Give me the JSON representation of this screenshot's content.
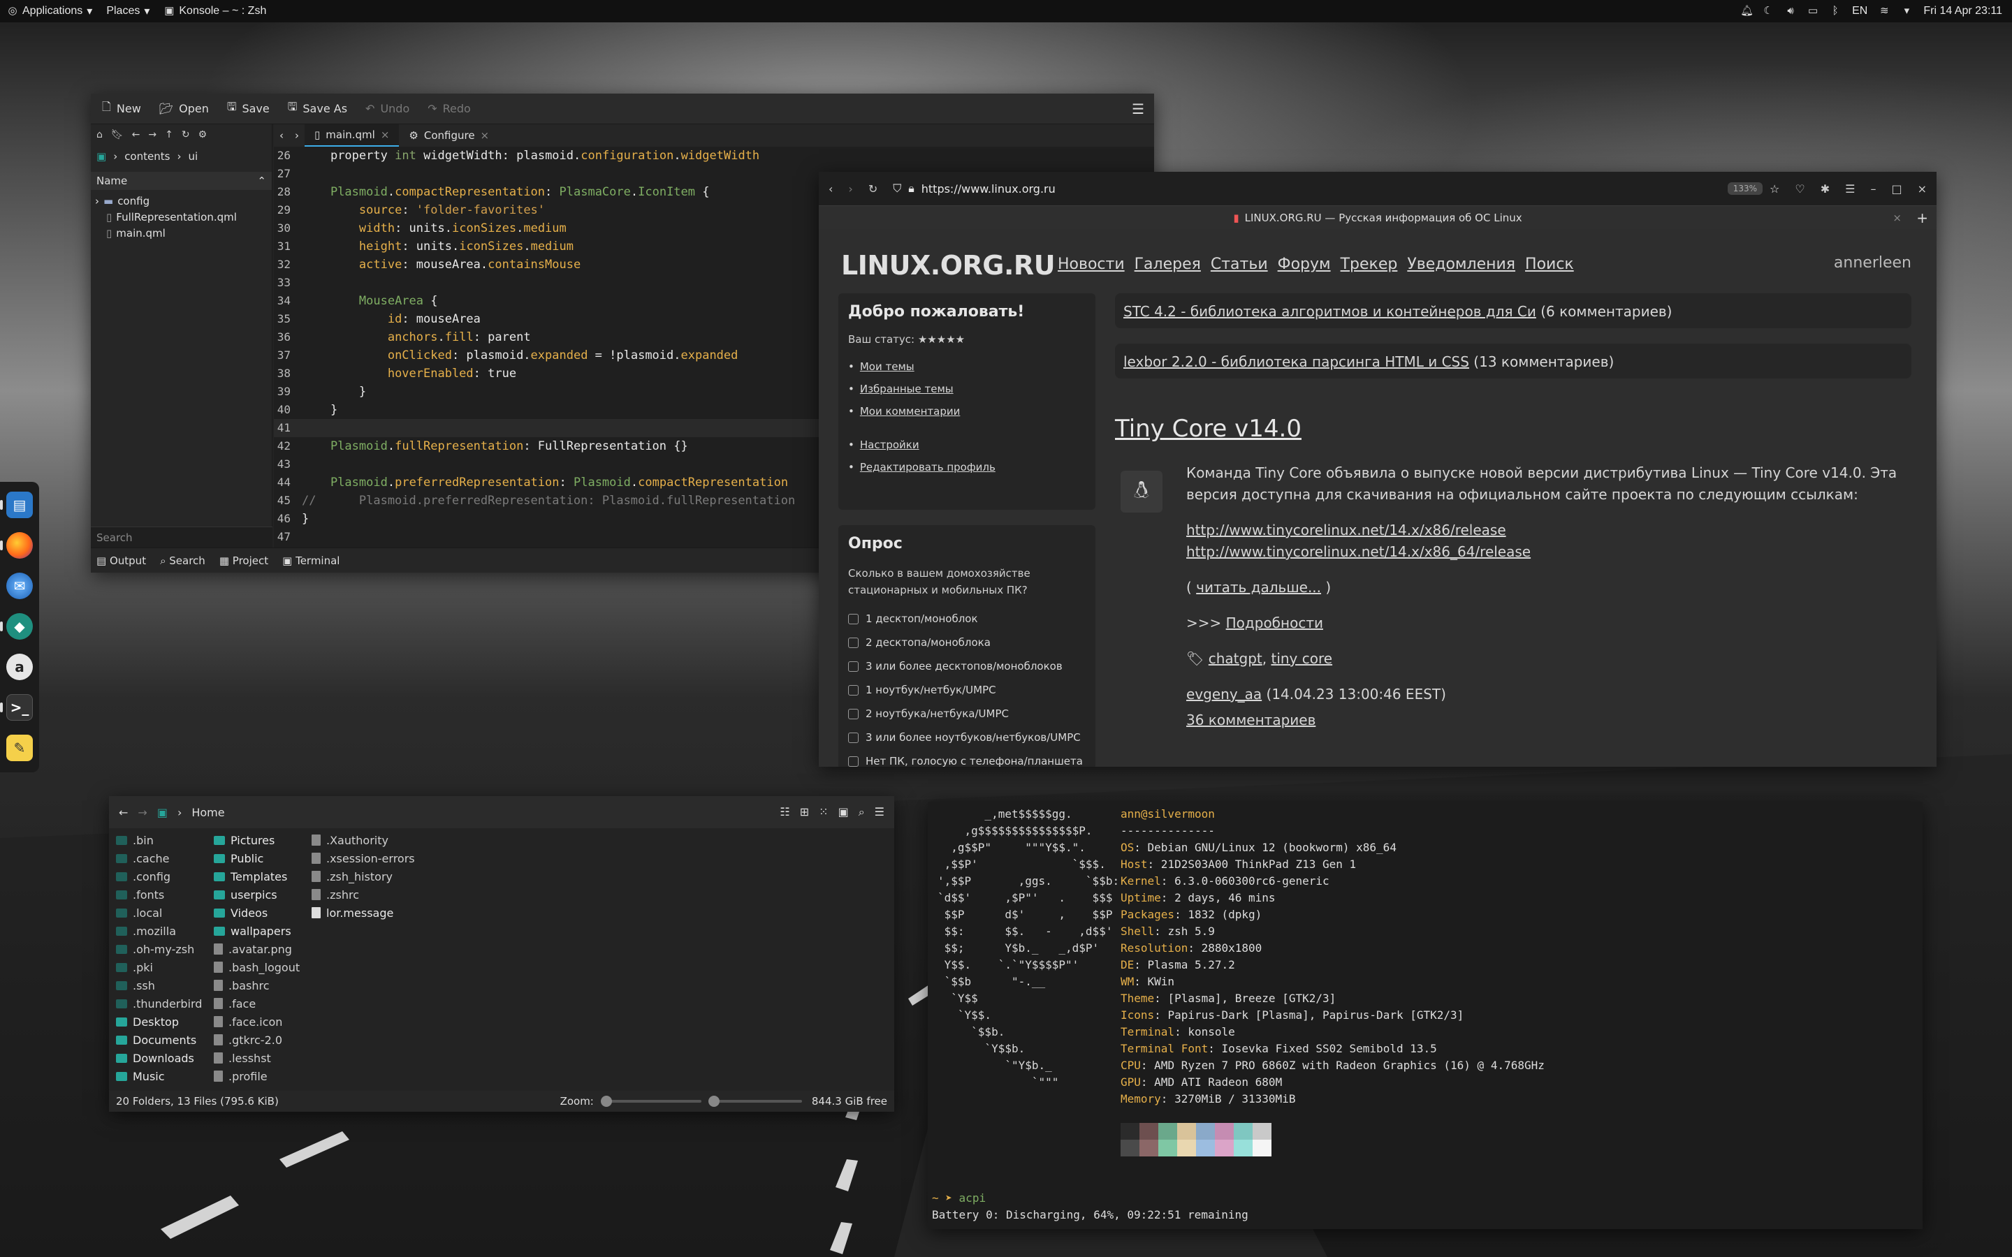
{
  "panel": {
    "applications": "Applications",
    "places": "Places",
    "window_title": "Konsole – ~ : Zsh",
    "lang": "EN",
    "clock": "Fri 14 Apr  23:11"
  },
  "kate": {
    "toolbar": {
      "new": "New",
      "open": "Open",
      "save": "Save",
      "save_as": "Save As",
      "undo": "Undo",
      "redo": "Redo"
    },
    "breadcrumb": [
      "contents",
      "ui"
    ],
    "tree_header": "Name",
    "tree": [
      "config",
      "FullRepresentation.qml",
      "main.qml"
    ],
    "search_placeholder": "Search",
    "tabs": [
      "main.qml",
      "Configure"
    ],
    "bottom_tabs": [
      "Output",
      "Search",
      "Project",
      "Terminal"
    ],
    "lines": [
      {
        "n": "26",
        "html": "    <span class='id'>property</span> <span class='kw'>int</span> <span class='id'>widgetWidth</span>: plasmoid.<span class='pr'>configuration</span>.<span class='pr'>widgetWidth</span>"
      },
      {
        "n": "27",
        "html": ""
      },
      {
        "n": "28",
        "html": "    <span class='ty'>Plasmoid</span>.<span class='pr'>compactRepresentation</span>: <span class='ty'>PlasmaCore</span>.<span class='ty'>IconItem</span> {"
      },
      {
        "n": "29",
        "html": "        <span class='pr'>source</span>: <span class='st'>'folder-favorites'</span>"
      },
      {
        "n": "30",
        "html": "        <span class='pr'>width</span>: units.<span class='pr'>iconSizes</span>.<span class='pr'>medium</span>"
      },
      {
        "n": "31",
        "html": "        <span class='pr'>height</span>: units.<span class='pr'>iconSizes</span>.<span class='pr'>medium</span>"
      },
      {
        "n": "32",
        "html": "        <span class='pr'>active</span>: mouseArea.<span class='pr'>containsMouse</span>"
      },
      {
        "n": "33",
        "html": ""
      },
      {
        "n": "34",
        "html": "        <span class='ty'>MouseArea</span> {"
      },
      {
        "n": "35",
        "html": "            <span class='pr'>id</span>: mouseArea"
      },
      {
        "n": "36",
        "html": "            <span class='pr'>anchors</span>.<span class='pr'>fill</span>: parent"
      },
      {
        "n": "37",
        "html": "            <span class='pr'>onClicked</span>: plasmoid.<span class='pr'>expanded</span> = !plasmoid.<span class='pr'>expanded</span>"
      },
      {
        "n": "38",
        "html": "            <span class='pr'>hoverEnabled</span>: true"
      },
      {
        "n": "39",
        "html": "        }"
      },
      {
        "n": "40",
        "html": "    }"
      },
      {
        "n": "41",
        "html": ""
      },
      {
        "n": "42",
        "html": "    <span class='ty'>Plasmoid</span>.<span class='pr'>fullRepresentation</span>: FullRepresentation {}"
      },
      {
        "n": "43",
        "html": ""
      },
      {
        "n": "44",
        "html": "    <span class='ty'>Plasmoid</span>.<span class='pr'>preferredRepresentation</span>: <span class='ty'>Plasmoid</span>.<span class='pr'>compactRepresentation</span>"
      },
      {
        "n": "45",
        "html": "<span class='cm'>//      Plasmoid.preferredRepresentation: Plasmoid.fullRepresentation</span>"
      },
      {
        "n": "46",
        "html": "}"
      },
      {
        "n": "47",
        "html": ""
      }
    ]
  },
  "browser": {
    "url": "https://www.linux.org.ru",
    "zoom": "133%",
    "tab_title": "LINUX.ORG.RU — Русская информация об ОС Linux",
    "site_title": "LINUX.ORG.RU",
    "nav": [
      "Новости",
      "Галерея",
      "Статьи",
      "Форум",
      "Трекер",
      "Уведомления",
      "Поиск"
    ],
    "user": "annerleen",
    "welcome_title": "Добро пожаловать!",
    "status_label": "Ваш статус:",
    "status_stars": "★★★★★",
    "welcome_links": [
      "Мои темы",
      "Избранные темы",
      "Мои комментарии",
      "Настройки",
      "Редактировать профиль"
    ],
    "poll_title": "Опрос",
    "poll_question": "Сколько в вашем домохозяйстве стационарных и мобильных ПК?",
    "poll_options": [
      "1 десктоп/моноблок",
      "2 десктопа/моноблока",
      "3 или более десктопов/моноблоков",
      "1 ноутбук/нетбук/UMPC",
      "2 ноутбука/нетбука/UMPC",
      "3 или более ноутбуков/нетбуков/UMPC",
      "Нет ПК, голосую с телефона/планшета"
    ],
    "news": [
      {
        "link": "STC 4.2 - библиотека алгоритмов и контейнеров для Си",
        "tail": " (6 комментариев)"
      },
      {
        "link": "lexbor 2.2.0 - библиотека парсинга HTML и CSS",
        "tail": " (13 комментариев)"
      }
    ],
    "article": {
      "title": "Tiny Core v14.0",
      "body": "Команда Tiny Core объявила о выпуске новой версии дистрибутива Linux — Tiny Core v14.0. Эта версия доступна для скачивания на официальном сайте проекта по следующим ссылкам:",
      "link1": "http://www.tinycorelinux.net/14.x/x86/release",
      "link2": "http://www.tinycorelinux.net/14.x/x86_64/release",
      "read_more_pre": "( ",
      "read_more": "читать дальше...",
      "read_more_post": " )",
      "details_pre": ">>> ",
      "details": "Подробности",
      "tag1": "chatgpt",
      "tag_sep": ", ",
      "tag2": "tiny core",
      "author": "evgeny_aa",
      "date": " (14.04.23 13:00:46 EEST)",
      "comments": "36 комментариев"
    }
  },
  "files": {
    "location": "Home",
    "items": [
      {
        "name": ".bin",
        "t": "dh"
      },
      {
        "name": ".cache",
        "t": "dh"
      },
      {
        "name": ".config",
        "t": "dh"
      },
      {
        "name": ".fonts",
        "t": "dh"
      },
      {
        "name": ".local",
        "t": "dh"
      },
      {
        "name": ".mozilla",
        "t": "dh"
      },
      {
        "name": ".oh-my-zsh",
        "t": "dh"
      },
      {
        "name": ".pki",
        "t": "dh"
      },
      {
        "name": ".ssh",
        "t": "dh"
      },
      {
        "name": ".thunderbird",
        "t": "dh"
      },
      {
        "name": "Desktop",
        "t": "d"
      },
      {
        "name": "Documents",
        "t": "d"
      },
      {
        "name": "Downloads",
        "t": "d"
      },
      {
        "name": "Music",
        "t": "d"
      },
      {
        "name": "Pictures",
        "t": "d"
      },
      {
        "name": "Public",
        "t": "d"
      },
      {
        "name": "Templates",
        "t": "d"
      },
      {
        "name": "userpics",
        "t": "d"
      },
      {
        "name": "Videos",
        "t": "d"
      },
      {
        "name": "wallpapers",
        "t": "d"
      },
      {
        "name": ".avatar.png",
        "t": "fh"
      },
      {
        "name": ".bash_logout",
        "t": "fh"
      },
      {
        "name": ".bashrc",
        "t": "fh"
      },
      {
        "name": ".face",
        "t": "fh"
      },
      {
        "name": ".face.icon",
        "t": "fh"
      },
      {
        "name": ".gtkrc-2.0",
        "t": "fh"
      },
      {
        "name": ".lesshst",
        "t": "fh"
      },
      {
        "name": ".profile",
        "t": "fh"
      },
      {
        "name": ".Xauthority",
        "t": "fh"
      },
      {
        "name": ".xsession-errors",
        "t": "fh"
      },
      {
        "name": ".zsh_history",
        "t": "fh"
      },
      {
        "name": ".zshrc",
        "t": "fh"
      },
      {
        "name": "lor.message",
        "t": "f"
      }
    ],
    "status": "20 Folders, 13 Files (795.6 KiB)",
    "zoom_label": "Zoom:",
    "free": "844.3 GiB free"
  },
  "terminal": {
    "ascii": "       _,met$$$$$gg.\n    ,g$$$$$$$$$$$$$$$P.\n  ,g$$P\"     \"\"\"Y$$.\".\n ,$$P'              `$$$.\n',$$P       ,ggs.     `$$b:\n`d$$'     ,$P\"'   .    $$$\n $$P      d$'     ,    $$P\n $$:      $$.   -    ,d$$'\n $$;      Y$b._   _,d$P'\n Y$$.    `.`\"Y$$$$P\"'\n `$$b      \"-.__\n  `Y$$\n   `Y$$.\n     `$$b.\n       `Y$$b.\n          `\"Y$b._\n              `\"\"\"",
    "user": "ann@silvermoon",
    "sep": "--------------",
    "info": [
      {
        "k": "OS",
        "v": "Debian GNU/Linux 12 (bookworm) x86_64"
      },
      {
        "k": "Host",
        "v": "21D2S03A00 ThinkPad Z13 Gen 1"
      },
      {
        "k": "Kernel",
        "v": "6.3.0-060300rc6-generic"
      },
      {
        "k": "Uptime",
        "v": "2 days, 46 mins"
      },
      {
        "k": "Packages",
        "v": "1832 (dpkg)"
      },
      {
        "k": "Shell",
        "v": "zsh 5.9"
      },
      {
        "k": "Resolution",
        "v": "2880x1800"
      },
      {
        "k": "DE",
        "v": "Plasma 5.27.2"
      },
      {
        "k": "WM",
        "v": "KWin"
      },
      {
        "k": "Theme",
        "v": "[Plasma], Breeze [GTK2/3]"
      },
      {
        "k": "Icons",
        "v": "Papirus-Dark [Plasma], Papirus-Dark [GTK2/3]"
      },
      {
        "k": "Terminal",
        "v": "konsole"
      },
      {
        "k": "Terminal Font",
        "v": "Iosevka Fixed SS02 Semibold 13.5"
      },
      {
        "k": "CPU",
        "v": "AMD Ryzen 7 PRO 6860Z with Radeon Graphics (16) @ 4.768GHz"
      },
      {
        "k": "GPU",
        "v": "AMD ATI Radeon 680M"
      },
      {
        "k": "Memory",
        "v": "3270MiB / 31330MiB"
      }
    ],
    "palette": [
      "#2b2b2b",
      "#6d4f4f",
      "#6aa88b",
      "#d9c39a",
      "#8aa9c9",
      "#c58cb2",
      "#7fc7c1",
      "#c9c9c9",
      "#4a4a4a",
      "#8b6767",
      "#7fc7a4",
      "#e9d7b0",
      "#9cbde0",
      "#dba4c8",
      "#98e0da",
      "#f5f5f5"
    ],
    "prompt": "~ ➤",
    "command": "acpi",
    "output": "Battery 0: Discharging, 64%, 09:22:51 remaining"
  }
}
